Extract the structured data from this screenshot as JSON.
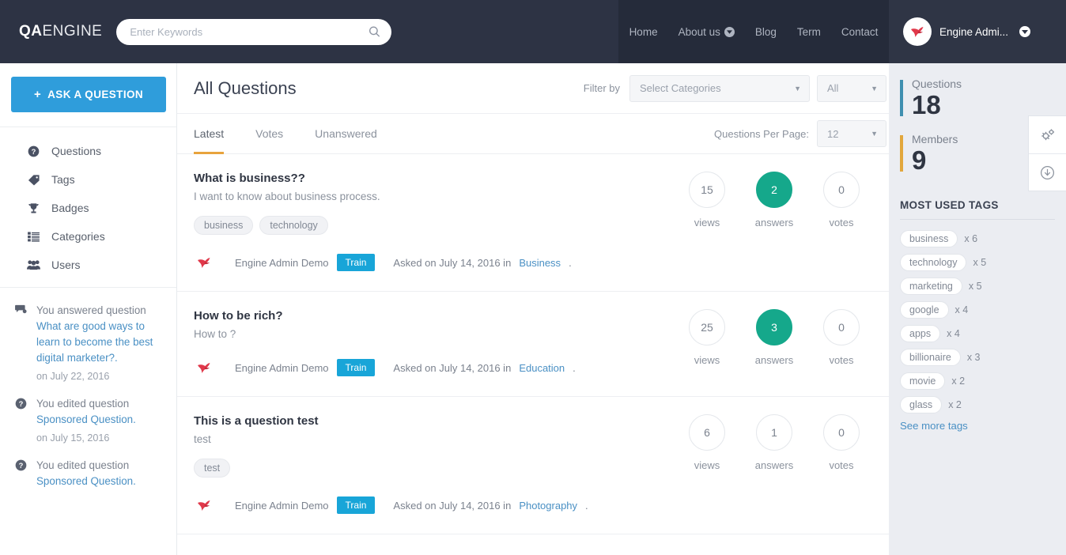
{
  "header": {
    "logo_bold": "QA",
    "logo_light": "ENGINE",
    "search": {
      "placeholder": "Enter Keywords",
      "value": "",
      "icon": "search-icon"
    },
    "nav": [
      {
        "label": "Home",
        "has_caret": false
      },
      {
        "label": "About us",
        "has_caret": true
      },
      {
        "label": "Blog",
        "has_caret": false
      },
      {
        "label": "Term",
        "has_caret": false
      },
      {
        "label": "Contact",
        "has_caret": false
      }
    ],
    "user": {
      "name": "Engine Admi...",
      "avatar_icon": "bird-avatar-icon",
      "caret_icon": "chevron-down-icon"
    },
    "colors": {
      "bar_bg": "#2d3344",
      "nav_bg": "#252b3a",
      "user_bg": "#2f3545"
    }
  },
  "sidebar": {
    "ask_button": {
      "label": "ASK A QUESTION",
      "icon": "plus-icon",
      "color": "#2f9ddb"
    },
    "items": [
      {
        "label": "Questions",
        "icon": "question-circle-icon"
      },
      {
        "label": "Tags",
        "icon": "tag-icon"
      },
      {
        "label": "Badges",
        "icon": "trophy-icon"
      },
      {
        "label": "Categories",
        "icon": "list-icon"
      },
      {
        "label": "Users",
        "icon": "users-icon"
      }
    ],
    "activity": [
      {
        "icon": "comment-icon",
        "lead": "You answered question",
        "link": "What are good ways to learn to become the best digital marketer?.",
        "date": "on July 22, 2016"
      },
      {
        "icon": "question-circle-icon",
        "lead": "You edited question",
        "link": "Sponsored Question.",
        "date": "on July 15, 2016"
      },
      {
        "icon": "question-circle-icon",
        "lead": "You edited question",
        "link": "Sponsored Question.",
        "date": ""
      }
    ]
  },
  "main": {
    "page_title": "All Questions",
    "filter_label": "Filter by",
    "category_select": {
      "value": "Select Categories",
      "caret": "chevron-down-icon"
    },
    "all_select": {
      "value": "All",
      "caret": "chevron-down-icon"
    },
    "tabs": [
      {
        "label": "Latest",
        "active": true
      },
      {
        "label": "Votes",
        "active": false
      },
      {
        "label": "Unanswered",
        "active": false
      }
    ],
    "active_tab_color": "#e8a33d",
    "per_page_label": "Questions Per Page:",
    "per_page_value": "12",
    "stat_labels": {
      "views": "views",
      "answers": "answers",
      "votes": "votes"
    },
    "answer_bubble_color": "#15a88b",
    "badge_color": "#18a5d8",
    "questions": [
      {
        "title": "What is business??",
        "excerpt": "I want to know about business process.",
        "tags": [
          "business",
          "technology"
        ],
        "author": "Engine Admin Demo",
        "badge": "Train",
        "asked_prefix": "Asked on July 14, 2016 in",
        "category": "Business",
        "views": "15",
        "answers": "2",
        "votes": "0",
        "avatar_icon": "bird-avatar-icon"
      },
      {
        "title": "How to be rich?",
        "excerpt": "How to ?",
        "tags": [],
        "author": "Engine Admin Demo",
        "badge": "Train",
        "asked_prefix": "Asked on July 14, 2016 in",
        "category": "Education",
        "views": "25",
        "answers": "3",
        "votes": "0",
        "avatar_icon": "bird-avatar-icon"
      },
      {
        "title": "This is a question test",
        "excerpt": "test",
        "tags": [
          "test"
        ],
        "author": "Engine Admin Demo",
        "badge": "Train",
        "asked_prefix": "Asked on July 14, 2016 in",
        "category": "Photography",
        "views": "6",
        "answers": "1",
        "votes": "0",
        "avatar_icon": "bird-avatar-icon"
      }
    ]
  },
  "rightbar": {
    "stats": [
      {
        "name": "Questions",
        "value": "18",
        "bar_color": "#3f8fb0"
      },
      {
        "name": "Members",
        "value": "9",
        "bar_color": "#e2a73c"
      }
    ],
    "tags_heading": "MOST USED TAGS",
    "tags": [
      {
        "name": "business",
        "count": "x 6"
      },
      {
        "name": "technology",
        "count": "x 5"
      },
      {
        "name": "marketing",
        "count": "x 5"
      },
      {
        "name": "google",
        "count": "x 4"
      },
      {
        "name": "apps",
        "count": "x 4"
      },
      {
        "name": "billionaire",
        "count": "x 3"
      },
      {
        "name": "movie",
        "count": "x 2"
      },
      {
        "name": "glass",
        "count": "x 2"
      }
    ],
    "see_more": "See more tags"
  },
  "float_panel": {
    "buttons": [
      {
        "icon": "gears-icon"
      },
      {
        "icon": "download-circle-icon"
      }
    ]
  }
}
